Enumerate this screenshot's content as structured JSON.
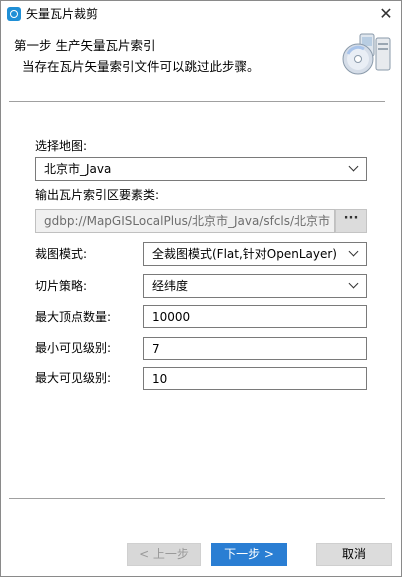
{
  "window": {
    "title": "矢量瓦片裁剪",
    "close_glyph": "✕"
  },
  "header": {
    "step_title": "第一步 生产矢量瓦片索引",
    "step_desc": "当存在瓦片矢量索引文件可以跳过此步骤。",
    "image_icon": "cd-disk-install-icon"
  },
  "form": {
    "map_label": "选择地图:",
    "map_value": "北京市_Java",
    "index_label": "输出瓦片索引区要素类:",
    "index_value": "gdbp://MapGISLocalPlus/北京市_Java/sfcls/北京市",
    "browse_label": "···",
    "crop_mode_label": "裁图模式:",
    "crop_mode_value": "全裁图模式(Flat,针对OpenLayer)",
    "slice_strategy_label": "切片策略:",
    "slice_strategy_value": "经纬度",
    "max_vertex_label": "最大顶点数量:",
    "max_vertex_value": "10000",
    "min_level_label": "最小可见级别:",
    "min_level_value": "7",
    "max_level_label": "最大可见级别:",
    "max_level_value": "10"
  },
  "buttons": {
    "prev": "< 上一步",
    "next": "下一步 >",
    "cancel": "取消"
  }
}
